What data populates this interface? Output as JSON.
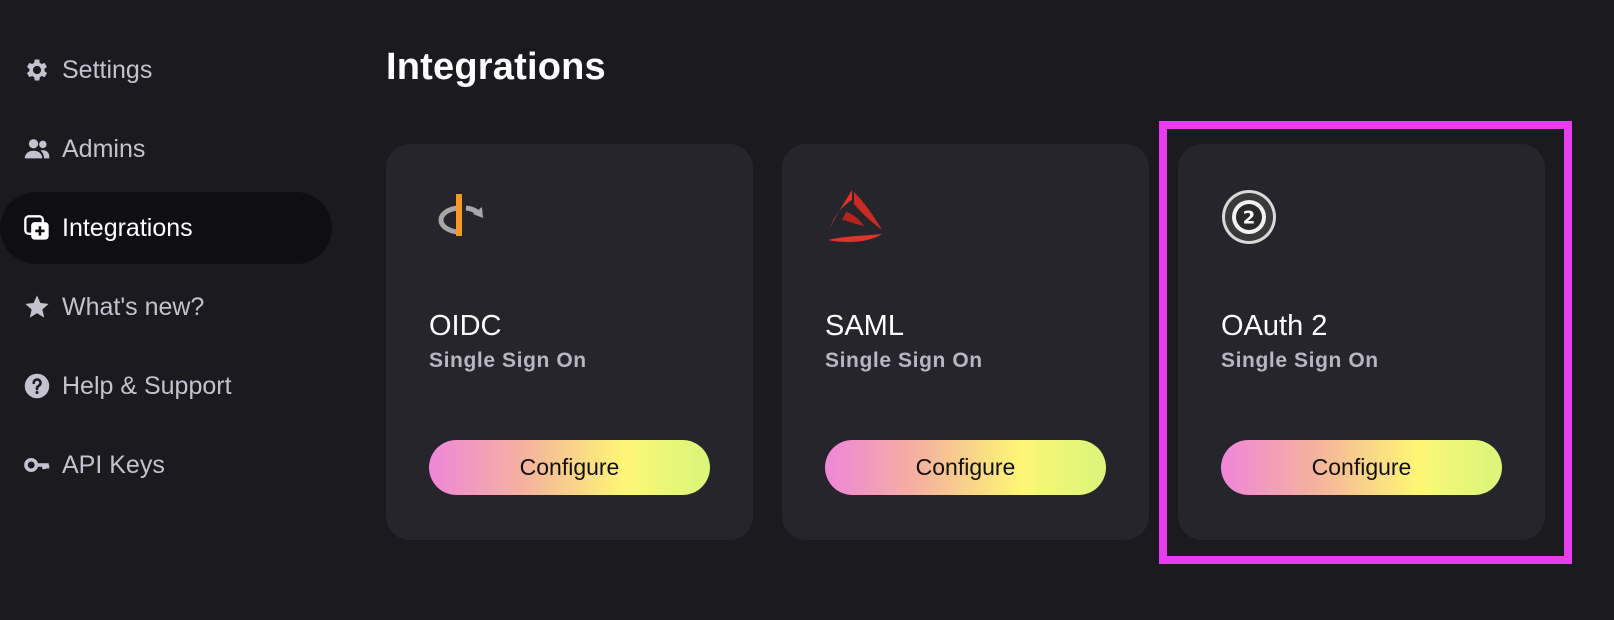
{
  "sidebar": {
    "items": [
      {
        "label": "Settings",
        "icon": "gear-icon",
        "active": false
      },
      {
        "label": "Admins",
        "icon": "users-icon",
        "active": false
      },
      {
        "label": "Integrations",
        "icon": "integrations-icon",
        "active": true
      },
      {
        "label": "What's new?",
        "icon": "star-icon",
        "active": false
      },
      {
        "label": "Help & Support",
        "icon": "help-icon",
        "active": false
      },
      {
        "label": "API Keys",
        "icon": "key-icon",
        "active": false
      }
    ]
  },
  "main": {
    "title": "Integrations",
    "cards": [
      {
        "name": "OIDC",
        "subtitle": "Single Sign On",
        "button_label": "Configure",
        "logo": "openid-logo"
      },
      {
        "name": "SAML",
        "subtitle": "Single Sign On",
        "button_label": "Configure",
        "logo": "saml-logo"
      },
      {
        "name": "OAuth 2",
        "subtitle": "Single Sign On",
        "button_label": "Configure",
        "logo": "oauth2-logo"
      }
    ]
  },
  "colors": {
    "background": "#1b1a1f",
    "card": "#27252c",
    "active_nav": "#0f0e12",
    "highlight": "#e83cf0",
    "button_gradient": [
      "#ef86d8",
      "#fdf775",
      "#d9f57a"
    ]
  }
}
